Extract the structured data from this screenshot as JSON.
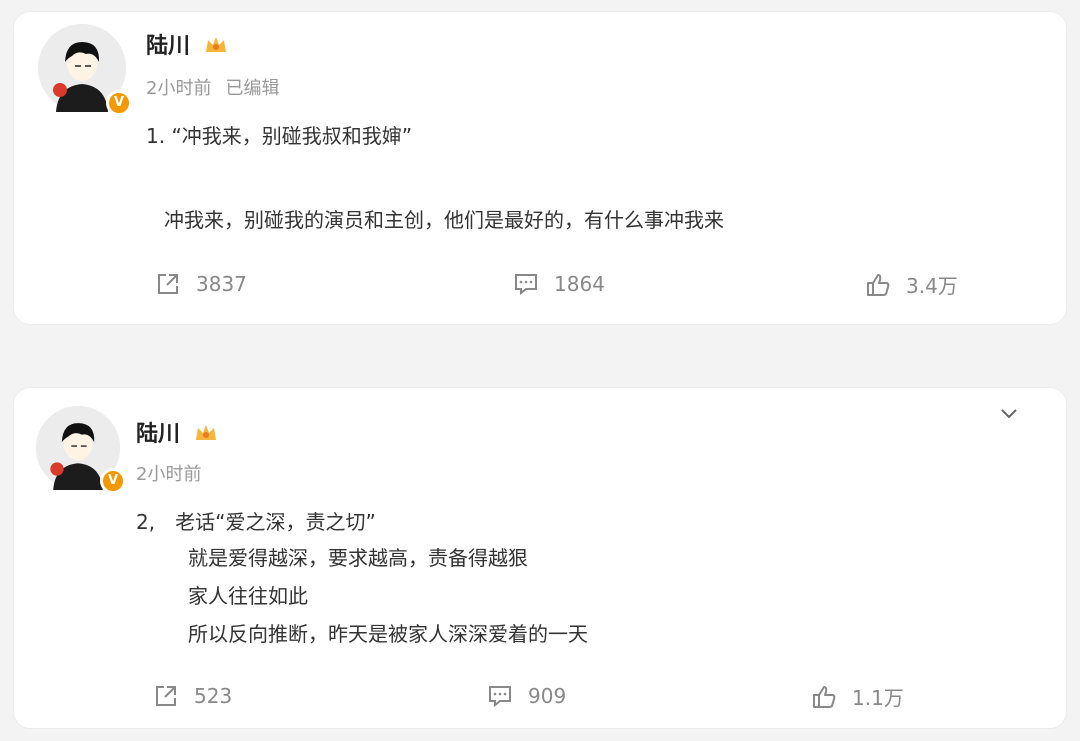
{
  "posts": [
    {
      "username": "陆川",
      "time": "2小时前",
      "edited": "已编辑",
      "lines": [
        "1. “冲我来，别碰我叔和我婶”",
        "冲我来，别碰我的演员和主创，他们是最好的，有什么事冲我来"
      ],
      "reposts": "3837",
      "comments": "1864",
      "likes": "3.4万"
    },
    {
      "username": "陆川",
      "time": "2小时前",
      "lines": [
        "2,　老话“爱之深，责之切”",
        "就是爱得越深，要求越高，责备得越狠",
        "家人往往如此",
        "所以反向推断，昨天是被家人深深爱着的一天"
      ],
      "reposts": "523",
      "comments": "909",
      "likes": "1.1万"
    }
  ],
  "colors": {
    "accent": "#f39800",
    "muted": "#888888",
    "background": "#f3f3f3"
  },
  "icons": [
    "share-icon",
    "comment-icon",
    "like-icon",
    "crown-icon",
    "verified-icon",
    "chevron-down-icon"
  ]
}
